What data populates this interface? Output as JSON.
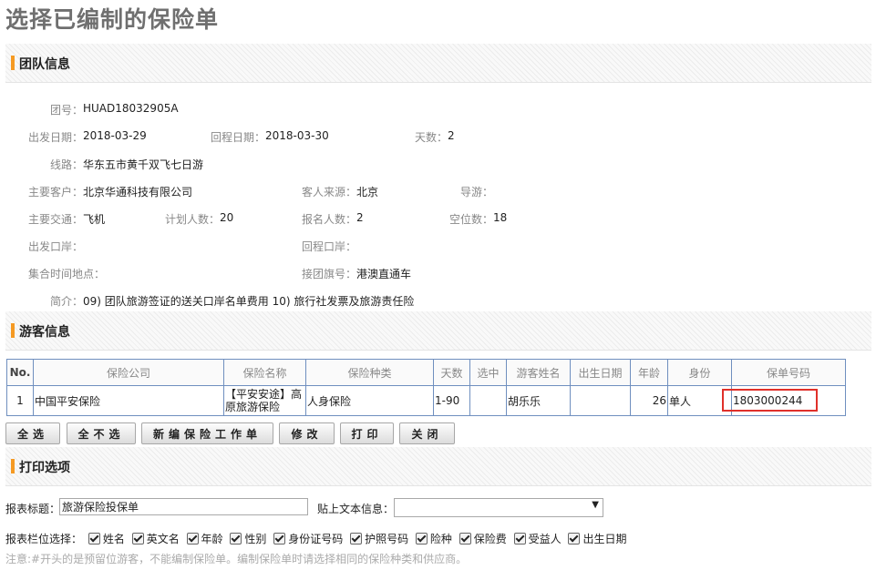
{
  "page_title": "选择已编制的保险单",
  "sections": {
    "team": "团队信息",
    "guests": "游客信息",
    "print": "打印选项"
  },
  "team_info": {
    "tour_no_label": "团号：",
    "tour_no": "HUAD18032905A",
    "depart_date_label": "出发日期：",
    "depart_date": "2018-03-29",
    "return_date_label": "回程日期：",
    "return_date": "2018-03-30",
    "days_label": "天数：",
    "days": "2",
    "route_label": "线路：",
    "route": "华东五市黄千双飞七日游",
    "client_label": "主要客户：",
    "client": "北京华通科技有限公司",
    "source_label": "客人来源：",
    "source": "北京",
    "guide_label": "导游：",
    "guide": "",
    "transport_label": "主要交通：",
    "transport": "飞机",
    "planned_label": "计划人数：",
    "planned": "20",
    "signed_label": "报名人数：",
    "signed": "2",
    "vacancy_label": "空位数：",
    "vacancy": "18",
    "depart_port_label": "出发口岸：",
    "depart_port": "",
    "return_port_label": "回程口岸：",
    "return_port": "",
    "meet_label": "集合时间地点：",
    "meet": "",
    "flag_label": "接团旗号：",
    "flag": "港澳直通车",
    "summary_label": "简介：",
    "summary": "09) 团队旅游签证的送关口岸名单费用 10) 旅行社发票及旅游责任险"
  },
  "guest_table": {
    "headers": [
      "No.",
      "保险公司",
      "保险名称",
      "保险种类",
      "天数",
      "选中",
      "游客姓名",
      "出生日期",
      "年龄",
      "身份",
      "保单号码"
    ],
    "rows": [
      {
        "no": "1",
        "company": "中国平安保险",
        "name": "【平安安途】高原旅游保险",
        "type": "人身保险",
        "days": "1-90",
        "selected": "",
        "guest": "胡乐乐",
        "birth": "",
        "age": "26",
        "identity": "单人",
        "policy_no": "1803000244"
      }
    ]
  },
  "buttons": {
    "select_all": "全选",
    "select_none": "全不选",
    "new_form": "新编保险工作单",
    "edit": "修改",
    "print": "打印",
    "close": "关闭"
  },
  "print_options": {
    "report_title_label": "报表标题：",
    "report_title": "旅游保险投保单",
    "attach_text_label": "贴上文本信息：",
    "attach_text_value": "",
    "columns_label": "报表栏位选择：",
    "columns": [
      "姓名",
      "英文名",
      "年龄",
      "性别",
      "身份证号码",
      "护照号码",
      "险种",
      "保险费",
      "受益人",
      "出生日期"
    ],
    "note": "注意:#开头的是预留位游客，不能编制保险单。编制保险单时请选择相同的保险种类和供应商。"
  },
  "colors": {
    "accent_bar": "#f59a23",
    "table_border": "#6f8fbf",
    "highlight": "#e0302a"
  }
}
